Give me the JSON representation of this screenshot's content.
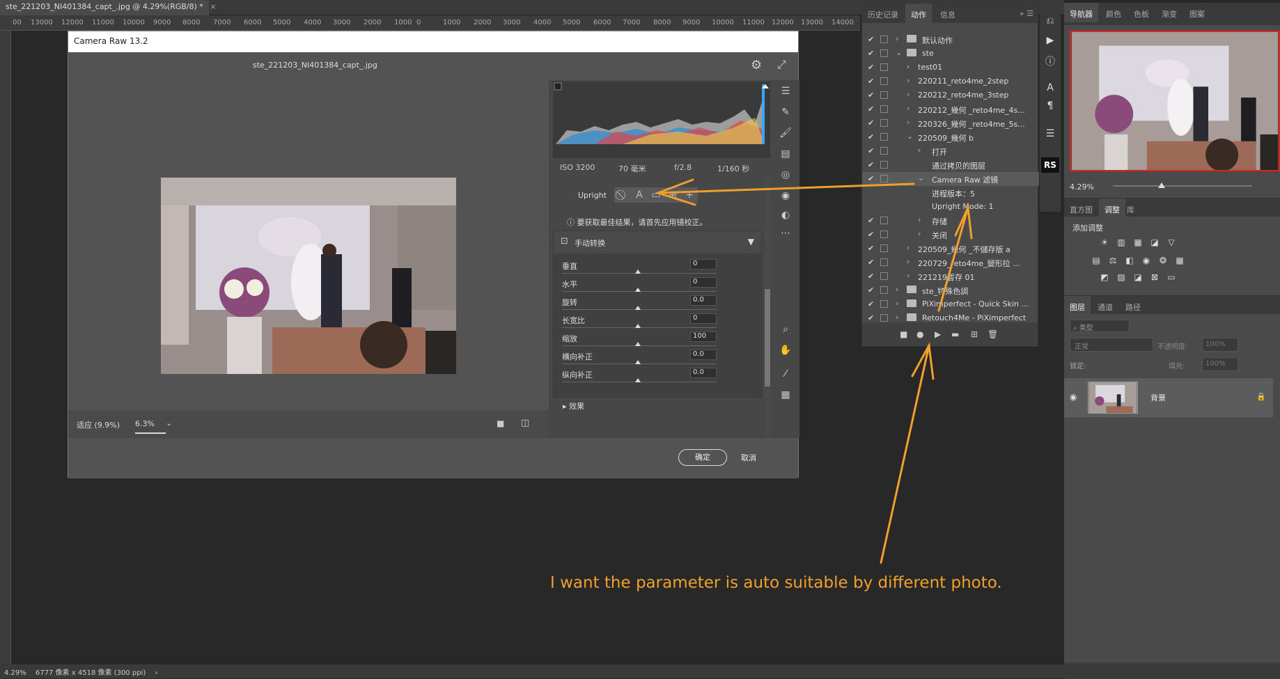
{
  "document_tab": {
    "title": "ste_221203_NI401384_capt_.jpg @ 4.29%(RGB/8) *",
    "close": "×"
  },
  "ruler": {
    "labels": [
      "00",
      "13000",
      "12000",
      "11000",
      "10000",
      "9000",
      "8000",
      "7000",
      "6000",
      "5000",
      "4000",
      "3000",
      "2000",
      "1000",
      "0",
      "1000",
      "2000",
      "3000",
      "4000",
      "5000",
      "6000",
      "7000",
      "8000",
      "9000",
      "10000",
      "11000",
      "12000",
      "13000",
      "14000"
    ]
  },
  "status_bar": {
    "zoom": "4.29%",
    "doc_info": "6777 像素 x 4518 像素 (300 ppi)",
    "arrow": "›"
  },
  "camera_raw": {
    "title": "Camera Raw 13.2",
    "filename": "ste_221203_NI401384_capt_.jpg",
    "fit_label": "适应 (9.9%)",
    "zoom_value": "6.3%",
    "meta": {
      "iso": "ISO 3200",
      "focal": "70 毫米",
      "aperture": "f/2.8",
      "shutter": "1/160 秒"
    },
    "upright_label": "Upright",
    "upright_buttons": [
      "⃠",
      "A",
      "▭",
      "⊞",
      "+"
    ],
    "hint": "要获取最佳结果，请首先应用镜校正。",
    "transform_title": "手动转换",
    "sliders": [
      {
        "label": "垂直",
        "value": "0"
      },
      {
        "label": "水平",
        "value": "0"
      },
      {
        "label": "旋转",
        "value": "0.0"
      },
      {
        "label": "长宽比",
        "value": "0"
      },
      {
        "label": "缩放",
        "value": "100"
      },
      {
        "label": "横向补正",
        "value": "0.0"
      },
      {
        "label": "纵向补正",
        "value": "0.0"
      }
    ],
    "next_section": "效果",
    "ok_label": "确定",
    "cancel_label": "取消"
  },
  "actions_panel": {
    "tabs": [
      "历史记录",
      "动作",
      "信息"
    ],
    "active_tab": "动作",
    "rows": [
      {
        "check": "✔",
        "text": "默认动作",
        "type": "set"
      },
      {
        "check": "✔",
        "text": "ste",
        "type": "set-open"
      },
      {
        "check": "✔",
        "text": "test01",
        "type": "action"
      },
      {
        "check": "✔",
        "text": "220211_reto4me_2step",
        "type": "action"
      },
      {
        "check": "✔",
        "text": "220212_reto4me_3step",
        "type": "action"
      },
      {
        "check": "✔",
        "text": "220212_幾何 _reto4me_4s...",
        "type": "action"
      },
      {
        "check": "✔",
        "text": "220326_幾何 _reto4me_5s...",
        "type": "action"
      },
      {
        "check": "✔",
        "text": "220509_幾何 b",
        "type": "action-open"
      },
      {
        "check": "✔",
        "text": "打开",
        "type": "step"
      },
      {
        "check": "✔",
        "text": "通过拷贝的图层",
        "type": "step-plain"
      },
      {
        "check": "✔",
        "text": "Camera Raw 滤镜",
        "type": "step-open"
      },
      {
        "check": "",
        "text": "进程版本：5",
        "type": "param"
      },
      {
        "check": "",
        "text": "Upright Mode: 1",
        "type": "param"
      },
      {
        "check": "✔",
        "text": "存储",
        "type": "step"
      },
      {
        "check": "✔",
        "text": "关闭",
        "type": "step"
      },
      {
        "check": "✔",
        "text": "220509_幾何 _不儲存版 a",
        "type": "action"
      },
      {
        "check": "✔",
        "text": "220729_reto4me_變形拉 ...",
        "type": "action"
      },
      {
        "check": "✔",
        "text": "221219暫存 01",
        "type": "action"
      },
      {
        "check": "✔",
        "text": "ste_特殊色調",
        "type": "set"
      },
      {
        "check": "✔",
        "text": "PiXimperfect - Quick Skin ...",
        "type": "set"
      },
      {
        "check": "✔",
        "text": "Retouch4Me - PiXimperfect",
        "type": "set"
      }
    ],
    "footer_buttons": [
      "■",
      "●",
      "▶",
      "▬",
      "⊞",
      "🗑"
    ]
  },
  "side_icons": {
    "rs_label": "RS"
  },
  "navigator": {
    "tabs": [
      "导航器",
      "颜色",
      "色板",
      "渐变",
      "图案"
    ],
    "zoom": "4.29%"
  },
  "adjustments": {
    "tabs": [
      "直方图",
      "调整",
      "库"
    ],
    "title": "添加调整"
  },
  "layers": {
    "tabs": [
      "图层",
      "通道",
      "路径"
    ],
    "filter": "类型",
    "blend_mode": "正常",
    "opacity_label": "不透明度:",
    "opacity": "100%",
    "lock_label": "锁定:",
    "fill_label": "填充:",
    "fill": "100%",
    "layer_name": "背景"
  },
  "annotation": {
    "text": "I want the parameter is auto suitable by different photo.",
    "color": "#f0a02c"
  }
}
